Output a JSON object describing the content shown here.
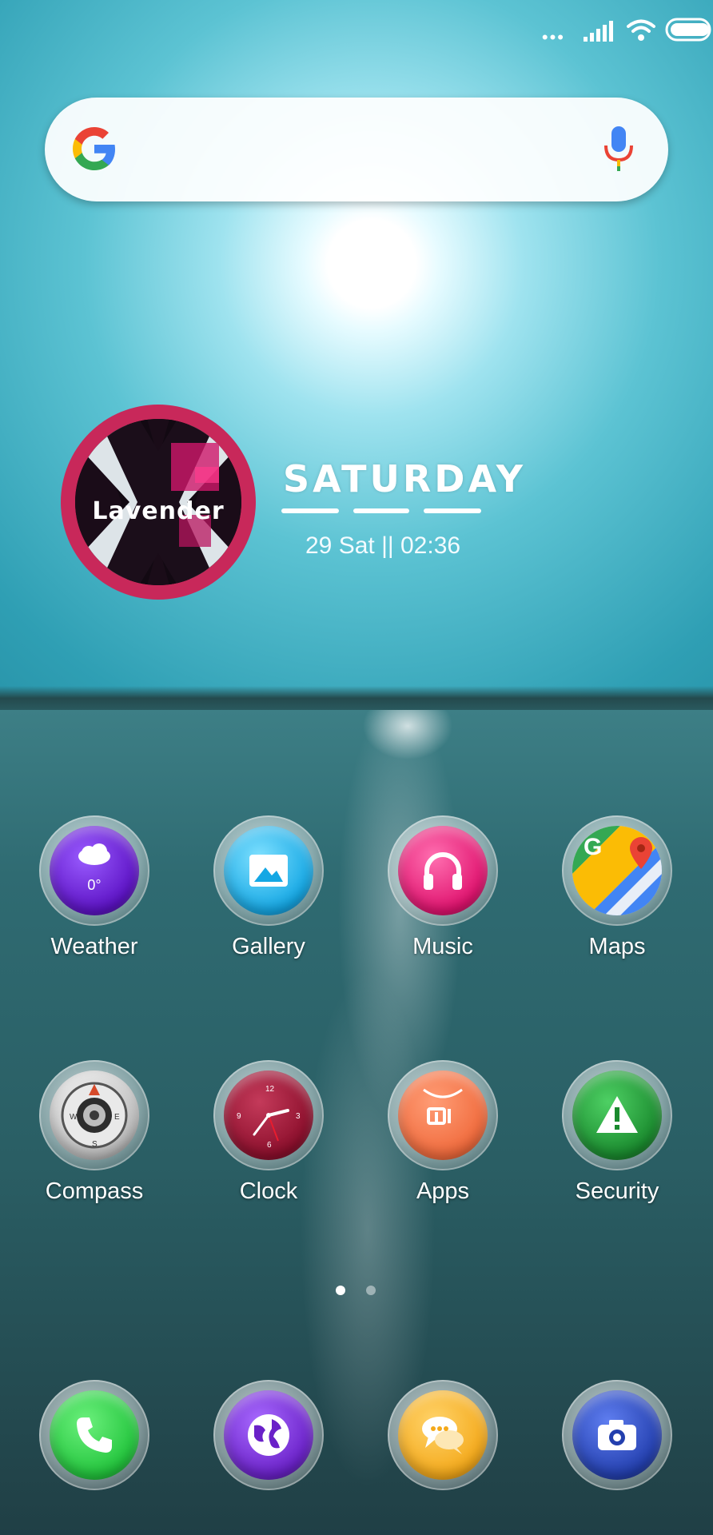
{
  "status_bar": {
    "dots": "•••"
  },
  "search": {
    "logo": "google-g-icon",
    "mic": "mic-icon"
  },
  "widget": {
    "album_label": "Lavender",
    "day": "SATURDAY",
    "date_time": "29 Sat || 02:36"
  },
  "apps_row1": [
    {
      "label": "Weather",
      "badge": "0°",
      "color": "#6a1fd0"
    },
    {
      "label": "Gallery",
      "color": "#22b6e8"
    },
    {
      "label": "Music",
      "color": "#e0126e"
    },
    {
      "label": "Maps",
      "color": "#34a853"
    }
  ],
  "apps_row2": [
    {
      "label": "Compass",
      "color": "#6b6b6b"
    },
    {
      "label": "Clock",
      "color": "#8c0f2c"
    },
    {
      "label": "Apps",
      "badge": "mi",
      "color": "#f06a3c"
    },
    {
      "label": "Security",
      "color": "#1a8a2e"
    }
  ],
  "dock": [
    {
      "name": "phone",
      "color": "#22c43c"
    },
    {
      "name": "browser",
      "color": "#6a21c8"
    },
    {
      "name": "messages",
      "color": "#f4a91a"
    },
    {
      "name": "camera",
      "color": "#233fae"
    }
  ],
  "pages": {
    "current": 1,
    "total": 2
  }
}
